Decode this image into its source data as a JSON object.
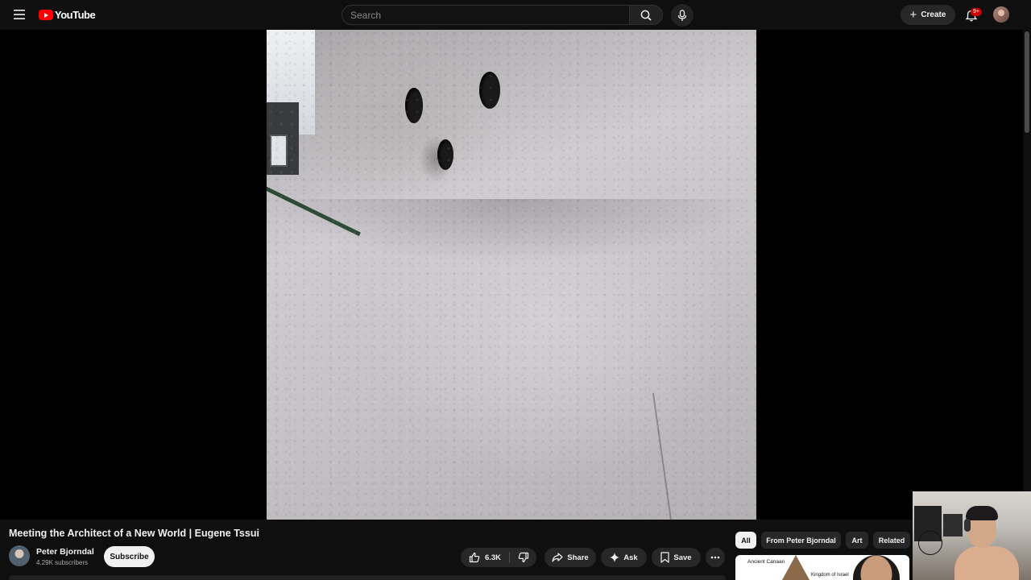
{
  "header": {
    "logo_text": "YouTube",
    "search_placeholder": "Search",
    "create_label": "Create",
    "notification_badge": "9+"
  },
  "video": {
    "title": "Meeting the Architect of a New World | Eugene Tssui"
  },
  "channel": {
    "name": "Peter Bjorndal",
    "subscribers": "4.29K subscribers",
    "subscribe_label": "Subscribe"
  },
  "actions": {
    "like_count": "6.3K",
    "share_label": "Share",
    "ask_label": "Ask",
    "save_label": "Save"
  },
  "chips": [
    {
      "label": "All",
      "active": true
    },
    {
      "label": "From Peter Bjorndal",
      "active": false
    },
    {
      "label": "Art",
      "active": false
    },
    {
      "label": "Related",
      "active": false
    }
  ],
  "recommended": [
    {
      "thumb_text_1": "Ancient Canaan",
      "thumb_text_2": "Kingdom of Israel"
    }
  ],
  "icons": [
    "menu-icon",
    "youtube-logo-icon",
    "search-icon",
    "mic-icon",
    "plus-icon",
    "bell-icon",
    "thumbs-up-icon",
    "thumbs-down-icon",
    "share-icon",
    "sparkle-icon",
    "bookmark-icon",
    "more-icon"
  ],
  "colors": {
    "background": "#0f0f0f",
    "brand_red": "#ff0000",
    "pill": "#272727",
    "badge": "#cc0000"
  }
}
